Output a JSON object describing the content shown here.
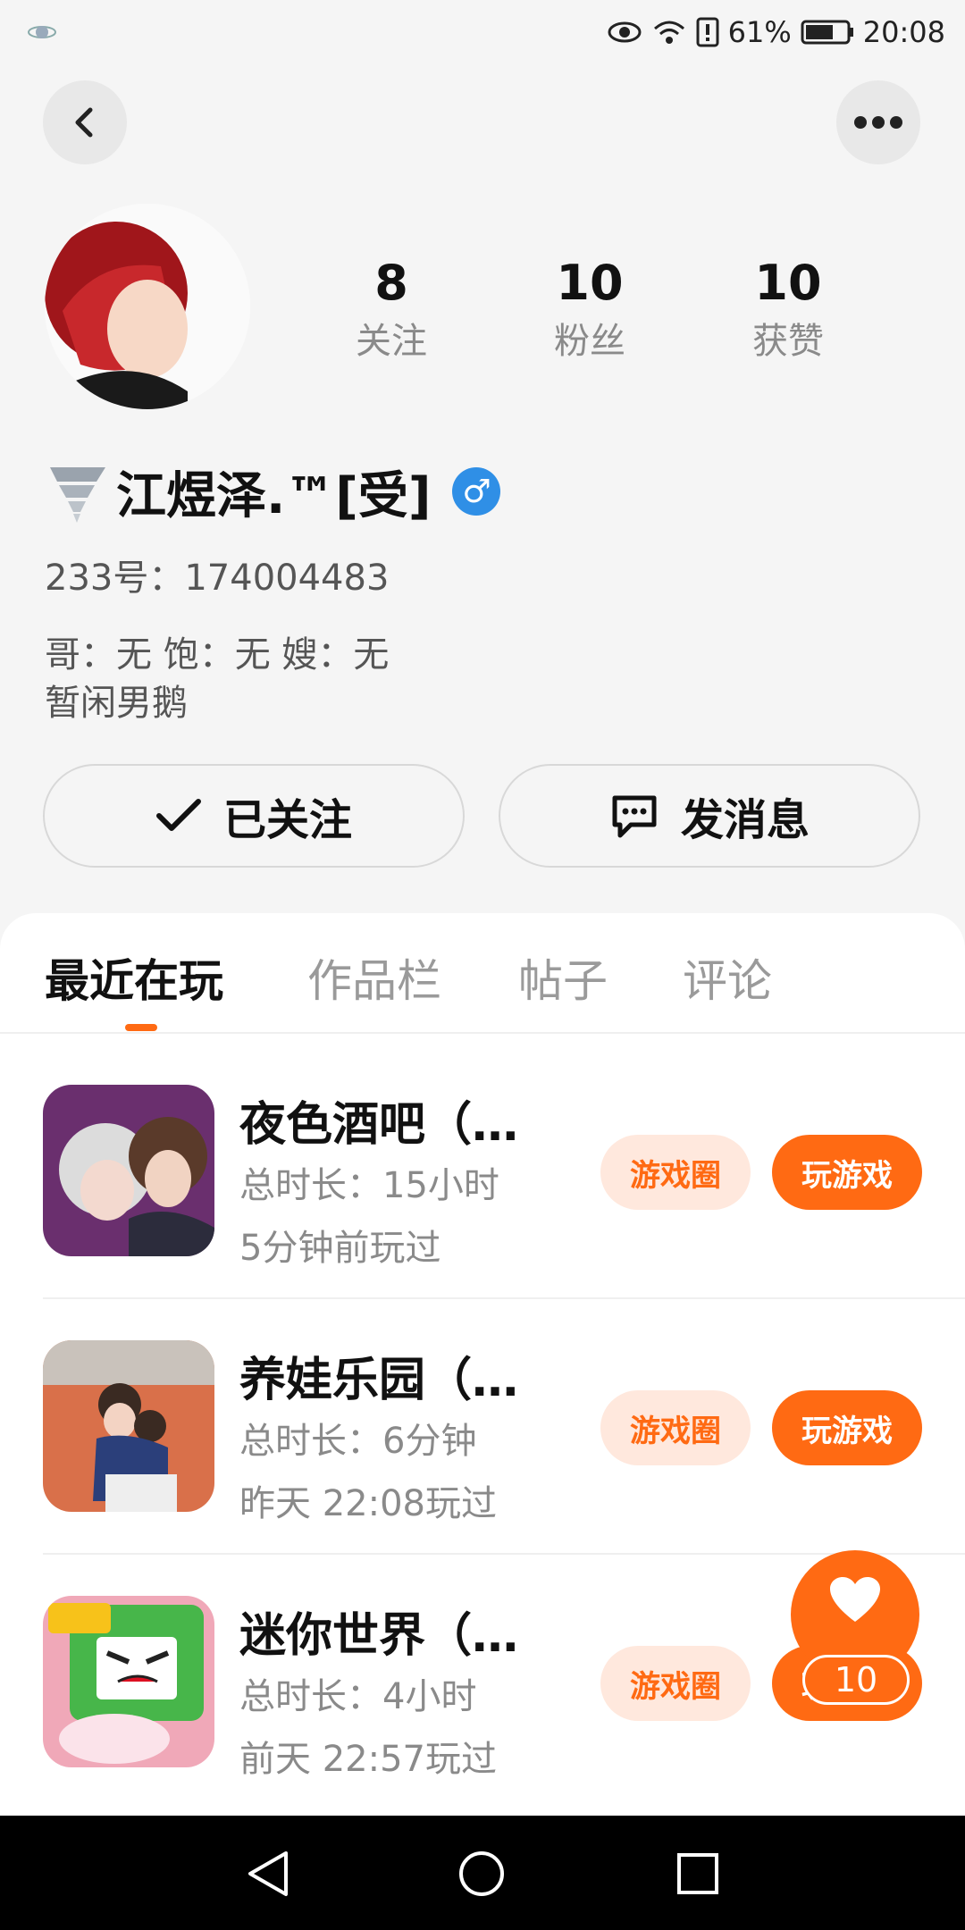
{
  "status": {
    "battery": "61%",
    "time": "20:08"
  },
  "profile": {
    "stats": [
      {
        "num": "8",
        "label": "关注"
      },
      {
        "num": "10",
        "label": "粉丝"
      },
      {
        "num": "10",
        "label": "获赞"
      }
    ],
    "name": "江煜泽.™[受]",
    "id_line": "233号：174004483",
    "bio_line1": "哥：无 饱：无 嫂：无",
    "bio_line2": "暂闲男鹅",
    "follow_label": "已关注",
    "message_label": "发消息"
  },
  "tabs": [
    {
      "label": "最近在玩",
      "active": true
    },
    {
      "label": "作品栏",
      "active": false
    },
    {
      "label": "帖子",
      "active": false
    },
    {
      "label": "评论",
      "active": false
    }
  ],
  "games": [
    {
      "title": "夜色酒吧（…",
      "duration": "总时长：15小时",
      "last_played": "5分钟前玩过",
      "circle": "游戏圈",
      "play": "玩游戏"
    },
    {
      "title": "养娃乐园（…",
      "duration": "总时长：6分钟",
      "last_played": "昨天 22:08玩过",
      "circle": "游戏圈",
      "play": "玩游戏"
    },
    {
      "title": "迷你世界（…",
      "duration": "总时长：4小时",
      "last_played": "前天 22:57玩过",
      "circle": "游戏圈",
      "play": "玩游戏"
    }
  ],
  "like_fab": {
    "count": "10"
  },
  "colors": {
    "accent": "#ff6a13",
    "accent_light": "#ffe8dd",
    "gender_blue": "#2f8fe6"
  }
}
